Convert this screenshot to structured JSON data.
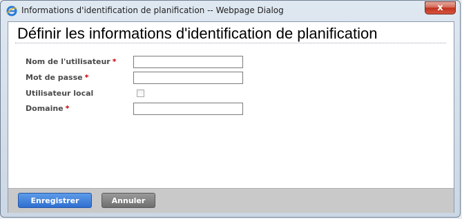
{
  "window": {
    "title": "Informations d'identification de planification -- Webpage Dialog",
    "close_glyph": "x"
  },
  "page": {
    "heading": "Définir les informations d'identification de planification"
  },
  "form": {
    "username": {
      "label": "Nom de l'utilisateur",
      "required_mark": "*",
      "value": ""
    },
    "password": {
      "label": "Mot de passe",
      "required_mark": "*",
      "value": ""
    },
    "local_user": {
      "label": "Utilisateur local",
      "checked": false
    },
    "domain": {
      "label": "Domaine",
      "required_mark": "*",
      "value": ""
    }
  },
  "footer": {
    "save_label": "Enregistrer",
    "cancel_label": "Annuler"
  },
  "colors": {
    "required": "#cc0000",
    "save_button": "#2f6fd0",
    "cancel_button": "#6f6f6f"
  }
}
